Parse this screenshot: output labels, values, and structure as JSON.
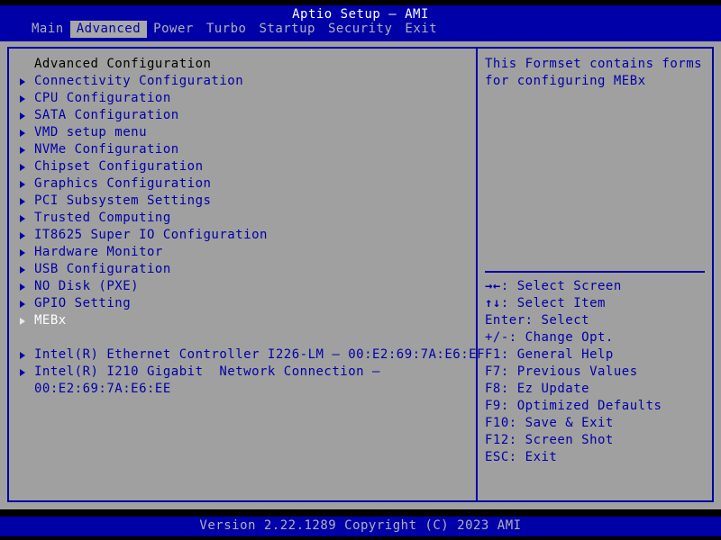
{
  "colors": {
    "screen_bg": "#000000",
    "panel_bg": "#a0a0a0",
    "bar_blue": "#0000a8",
    "text_blue": "#0000a8",
    "text_gray": "#b0b0b8",
    "text_white": "#ffffff",
    "text_black": "#000000"
  },
  "header": {
    "title": "Aptio Setup – AMI"
  },
  "tabs": [
    {
      "label": "Main",
      "selected": false
    },
    {
      "label": "Advanced",
      "selected": true
    },
    {
      "label": "Power",
      "selected": false
    },
    {
      "label": "Turbo",
      "selected": false
    },
    {
      "label": "Startup",
      "selected": false
    },
    {
      "label": "Security",
      "selected": false
    },
    {
      "label": "Exit",
      "selected": false
    }
  ],
  "main": {
    "section_heading": "Advanced Configuration",
    "items": [
      {
        "label": "Connectivity Configuration",
        "submenu": true,
        "selected": false
      },
      {
        "label": "CPU Configuration",
        "submenu": true,
        "selected": false
      },
      {
        "label": "SATA Configuration",
        "submenu": true,
        "selected": false
      },
      {
        "label": "VMD setup menu",
        "submenu": true,
        "selected": false
      },
      {
        "label": "NVMe Configuration",
        "submenu": true,
        "selected": false
      },
      {
        "label": "Chipset Configuration",
        "submenu": true,
        "selected": false
      },
      {
        "label": "Graphics Configuration",
        "submenu": true,
        "selected": false
      },
      {
        "label": "PCI Subsystem Settings",
        "submenu": true,
        "selected": false
      },
      {
        "label": "Trusted Computing",
        "submenu": true,
        "selected": false
      },
      {
        "label": "IT8625 Super IO Configuration",
        "submenu": true,
        "selected": false
      },
      {
        "label": "Hardware Monitor",
        "submenu": true,
        "selected": false
      },
      {
        "label": "USB Configuration",
        "submenu": true,
        "selected": false
      },
      {
        "label": "NO Disk (PXE)",
        "submenu": true,
        "selected": false
      },
      {
        "label": "GPIO Setting",
        "submenu": true,
        "selected": false
      },
      {
        "label": "MEBx",
        "submenu": true,
        "selected": true
      }
    ],
    "network_items": [
      {
        "label": "Intel(R) Ethernet Controller I226-LM – 00:E2:69:7A:E6:EF",
        "line1": "Intel(R) Ethernet Controller I226-LM – 00:E2:69:7A:E6:EF",
        "line2": "",
        "submenu": true
      },
      {
        "label": "Intel(R) I210 Gigabit  Network Connection – 00:E2:69:7A:E6:EE",
        "line1": "Intel(R) I210 Gigabit  Network Connection –",
        "line2": "00:E2:69:7A:E6:EE",
        "submenu": true
      }
    ]
  },
  "help": {
    "description": "This Formset contains forms for configuring MEBx",
    "keys": [
      {
        "glyph": "→←",
        "text": ": Select Screen"
      },
      {
        "glyph": "↑↓",
        "text": ": Select Item"
      },
      {
        "glyph": "",
        "text": "Enter: Select"
      },
      {
        "glyph": "",
        "text": "+/-: Change Opt."
      },
      {
        "glyph": "",
        "text": "F1: General Help"
      },
      {
        "glyph": "",
        "text": "F7: Previous Values"
      },
      {
        "glyph": "",
        "text": "F8: Ez Update"
      },
      {
        "glyph": "",
        "text": "F9: Optimized Defaults"
      },
      {
        "glyph": "",
        "text": "F10: Save & Exit"
      },
      {
        "glyph": "",
        "text": "F12: Screen Shot"
      },
      {
        "glyph": "",
        "text": "ESC: Exit"
      }
    ]
  },
  "footer": {
    "version_text": "Version 2.22.1289 Copyright (C) 2023 AMI"
  }
}
